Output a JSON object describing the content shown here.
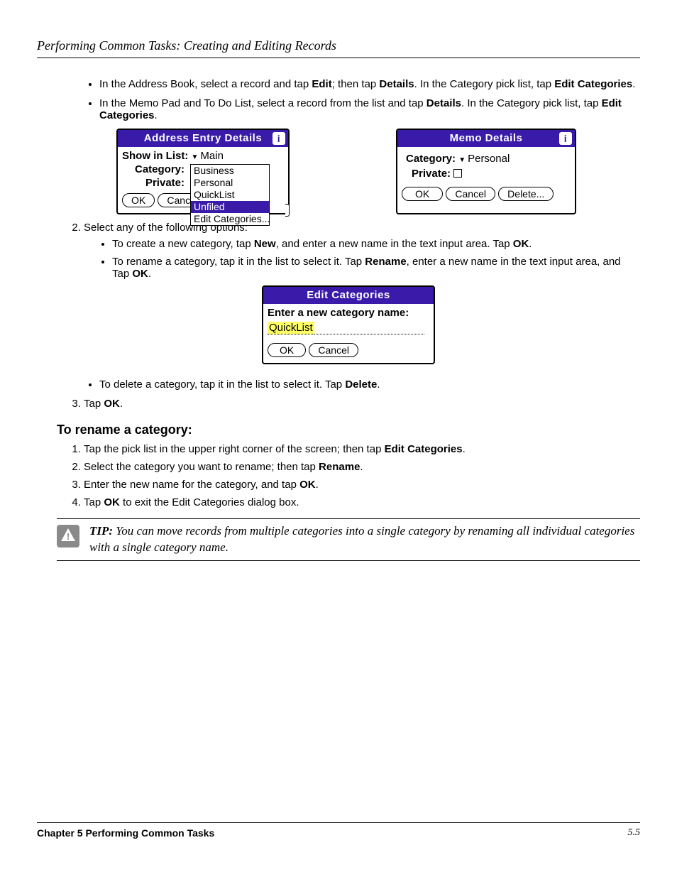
{
  "header": {
    "running": "Performing Common Tasks: Creating and Editing Records"
  },
  "b1": {
    "li1a": "In the Address Book, select a record and tap ",
    "edit": "Edit",
    "li1b": "; then tap ",
    "details": "Details",
    "li1c": ". In the Category pick list, tap ",
    "editcat": "Edit Categories",
    "period": ".",
    "li2a": "In the Memo Pad and To Do List, select a record from the list and tap ",
    "li2b": ". In the Category pick list, tap "
  },
  "addr": {
    "title": "Address Entry Details",
    "showin": "Show in List:",
    "showval": "Main",
    "cat": "Category:",
    "priv": "Private:",
    "ok": "OK",
    "cancel": "Cancel",
    "menu": {
      "i0": "Business",
      "i1": "Personal",
      "i2": "QuickList",
      "i3": "Unfiled",
      "i4": "Edit Categories..."
    }
  },
  "memo": {
    "title": "Memo Details",
    "cat": "Category:",
    "catval": "Personal",
    "priv": "Private:",
    "ok": "OK",
    "cancel": "Cancel",
    "delete": "Delete..."
  },
  "step2": "Select any of the following options:",
  "opt1a": "To create a new category, tap ",
  "new": "New",
  "opt1b": ", and enter a new name in the text input area. Tap ",
  "ok": "OK",
  "opt2a": "To rename a category, tap it in the list to select it. Tap ",
  "rename": "Rename",
  "opt2b": ", enter a new name in the text input area, and Tap ",
  "editdlg": {
    "title": "Edit Categories",
    "prompt": "Enter a new category name:",
    "value": "QuickList",
    "ok": "OK",
    "cancel": "Cancel"
  },
  "opt3a": "To delete a category, tap it in the list to select it. Tap ",
  "delete": "Delete",
  "step3a": "Tap ",
  "sec": "To rename a category:",
  "r1a": "Tap the pick list in the upper right corner of the screen; then tap ",
  "r2a": "Select the category you want to rename; then tap ",
  "r3a": "Enter the new name for the category, and tap ",
  "r4a": "Tap ",
  "r4b": " to exit the Edit Categories dialog box.",
  "tip": {
    "label": "TIP:",
    "text": " You can move records from multiple categories into a single category by renaming all individual categories with a single category name."
  },
  "footer": {
    "left": "Chapter 5 Performing Common Tasks",
    "right": "5.5"
  }
}
